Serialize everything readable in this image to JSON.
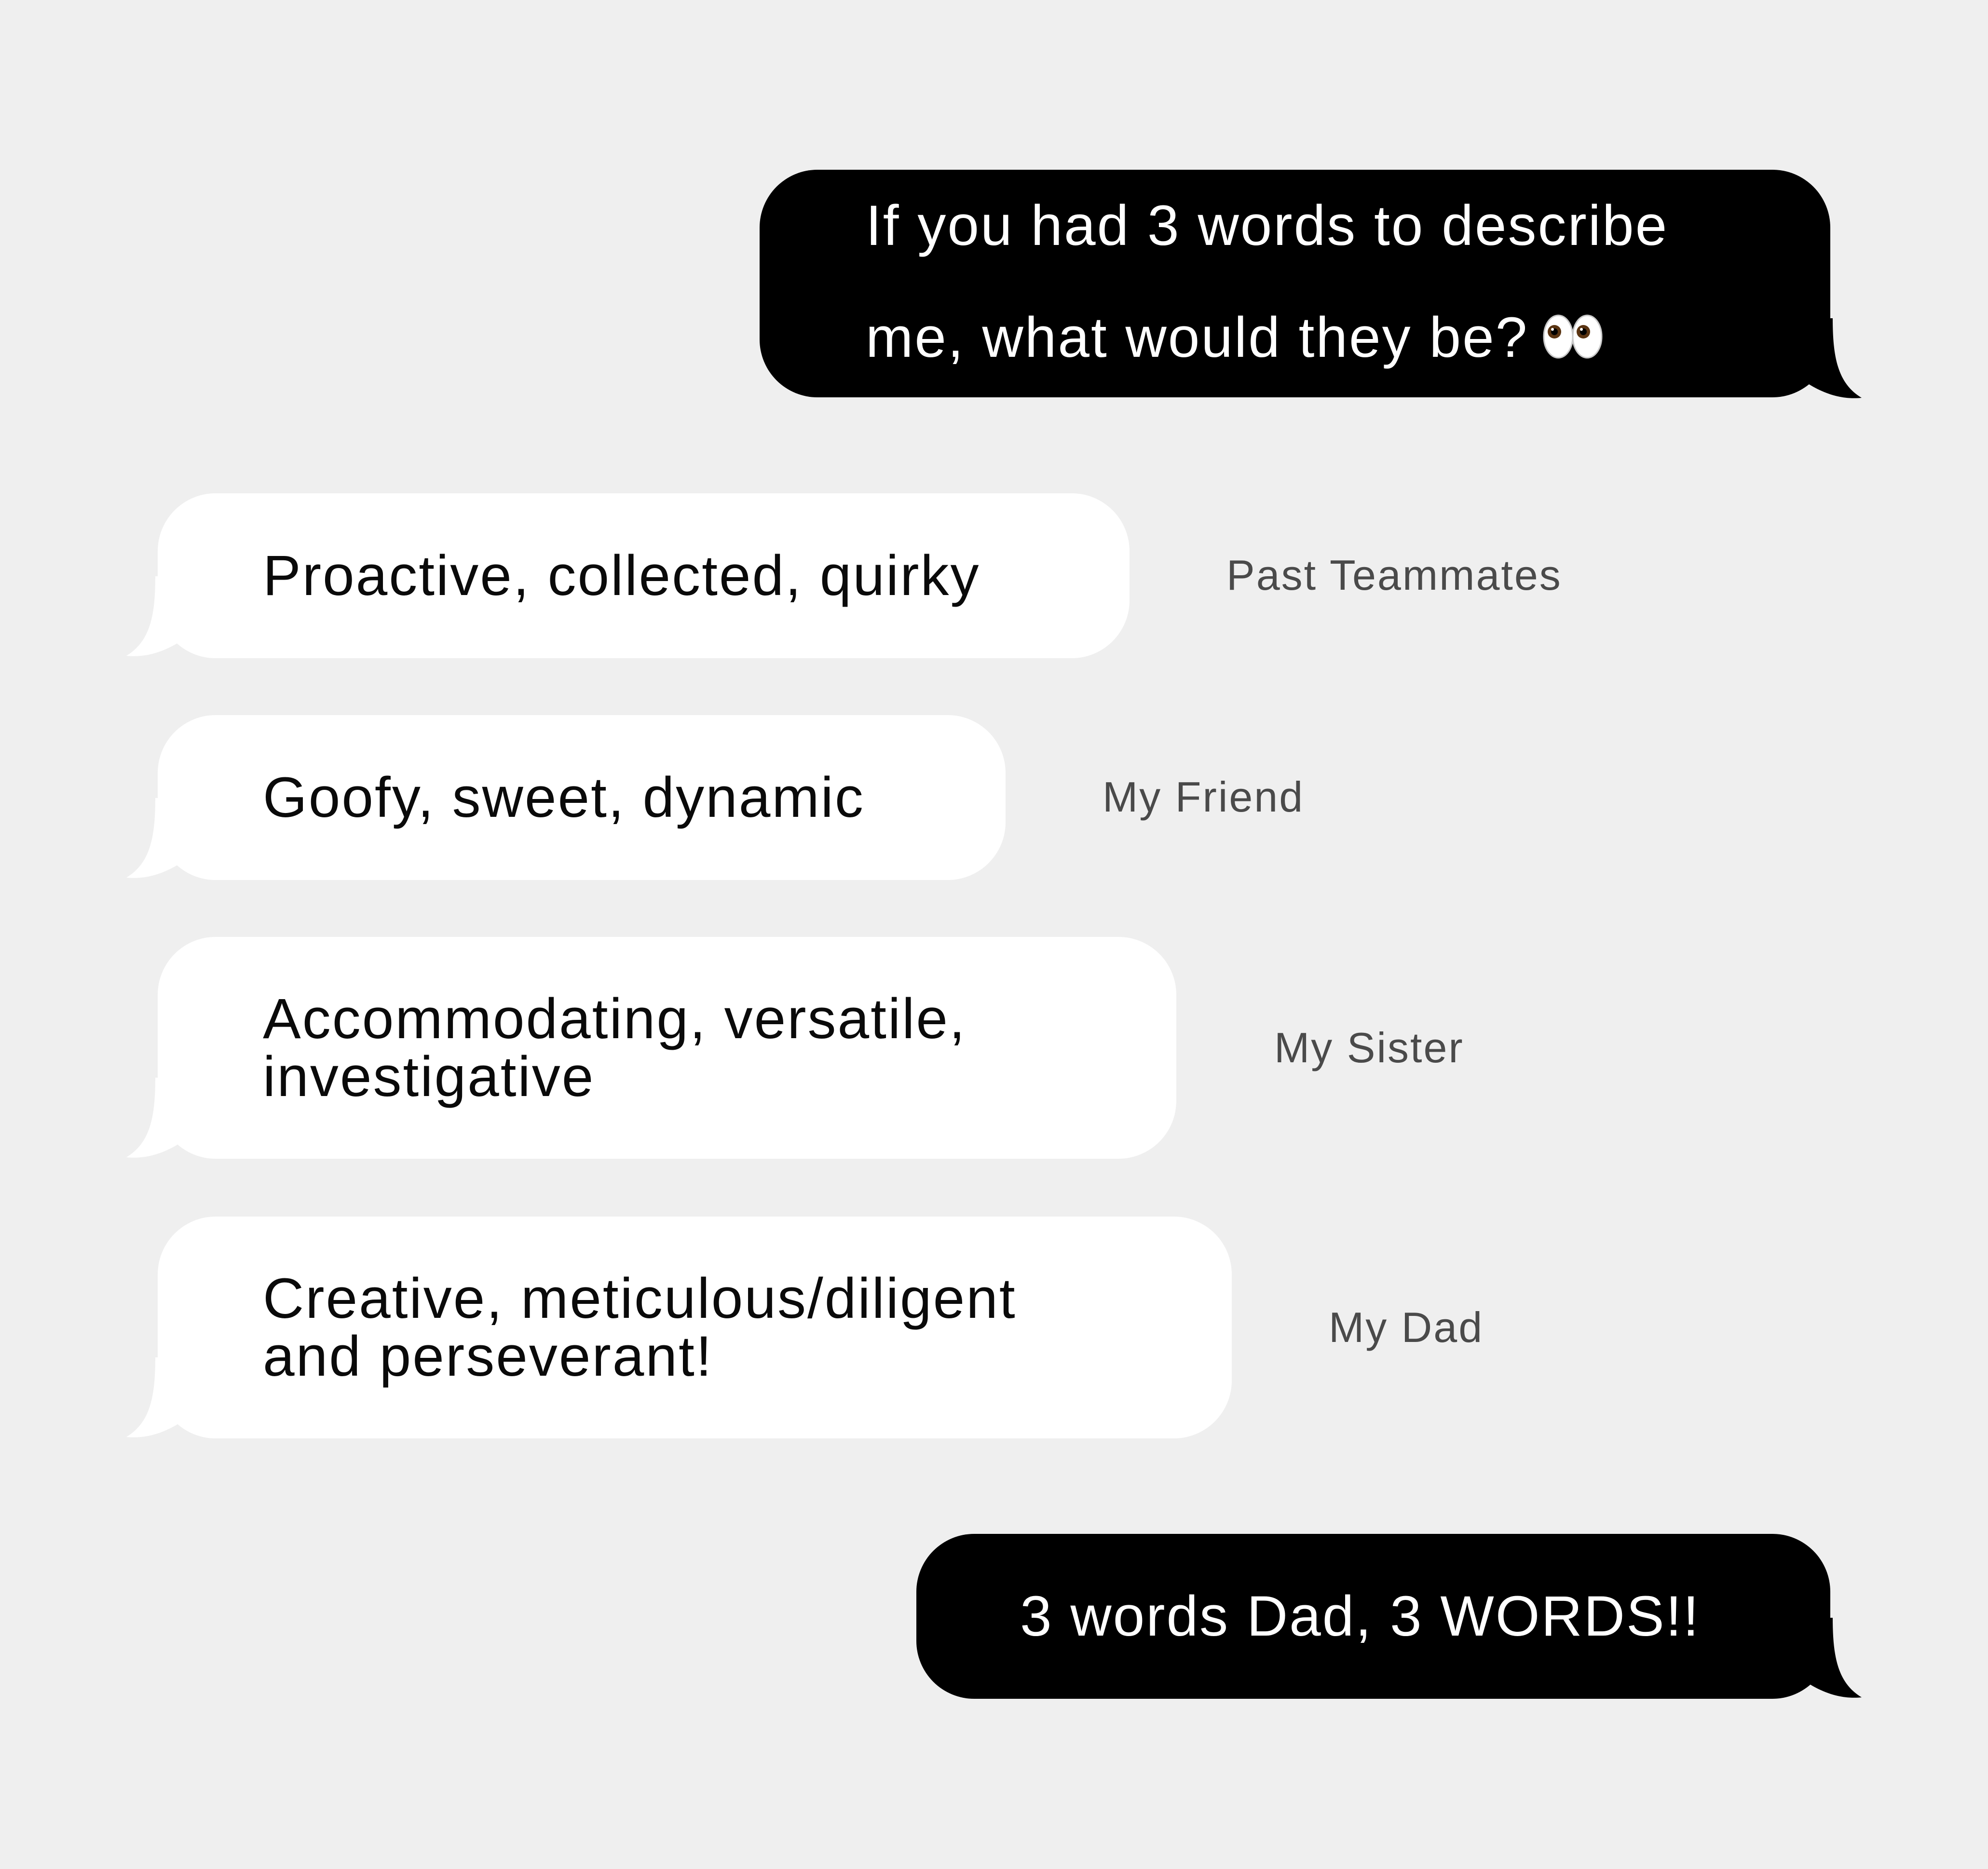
{
  "conversation": {
    "question": {
      "text": "If you had 3 words to describe\nme, what would they be?",
      "emoji": "👀"
    },
    "replies": [
      {
        "text": "Proactive, collected, quirky",
        "sender": "Past Teammates"
      },
      {
        "text": "Goofy, sweet, dynamic",
        "sender": "My Friend"
      },
      {
        "text": "Accommodating, versatile,\ninvestigative",
        "sender": "My Sister"
      },
      {
        "text": "Creative, meticulous/diligent\nand perseverant!",
        "sender": "My Dad"
      }
    ],
    "followup": {
      "text": "3 words Dad, 3 WORDS!!"
    }
  },
  "colors": {
    "background": "#efefef",
    "outgoing_bubble": "#000000",
    "outgoing_text": "#ffffff",
    "incoming_bubble": "#ffffff",
    "incoming_text": "#0a0a0a",
    "sender_label": "#4a4a4a"
  }
}
